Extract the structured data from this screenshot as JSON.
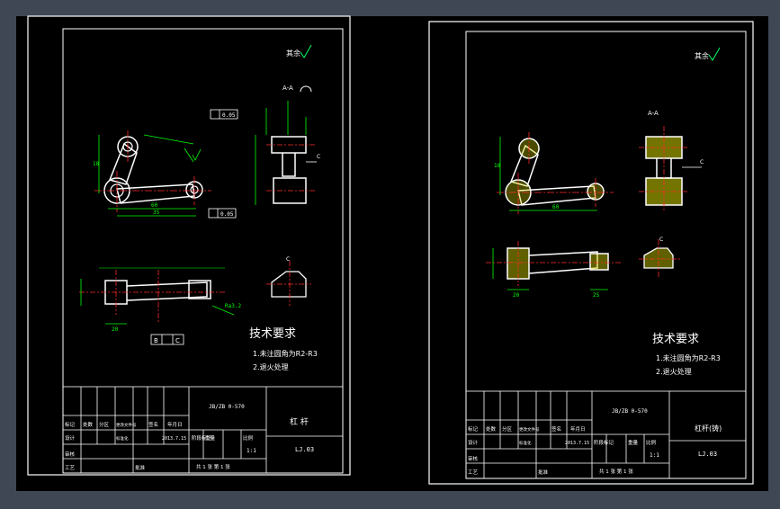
{
  "app": {
    "background": "#3f4654",
    "canvas": "#000000"
  },
  "colors": {
    "frame": "#ffffff",
    "part": "#ffffff",
    "dimension": "#00ff00",
    "center": "#ff2a2a",
    "hatch": "#d4d400",
    "text": "#ffffff",
    "accent": "#00ff66"
  },
  "sheets": [
    {
      "surface_finish": "其余",
      "section_label": "A-A",
      "section_c": "C",
      "tech_title": "技术要求",
      "tech_items": [
        "1.未注圆角为R2-R3",
        "2.退火处理"
      ],
      "tolerances": [
        "0.05",
        "0.05"
      ],
      "datum": [
        "B",
        "C"
      ],
      "dims": [
        "18",
        "20",
        "35",
        "60",
        "12",
        "8",
        "25",
        "17",
        "Ra3.2"
      ],
      "title_block": {
        "standard": "JB/ZB 0-570",
        "part_name": "杠   杆",
        "drawing_no": "LJ.03",
        "headers": [
          "标记",
          "处数",
          "分区",
          "更改文件号",
          "签名",
          "年月日"
        ],
        "row_design": "设计",
        "date": "2013.7.15",
        "standardization": "标准化",
        "stage": "阶段标记",
        "weight": "重量",
        "scale_label": "比例",
        "scale": "1:1",
        "review": "审核",
        "process": "工艺",
        "approve": "批准",
        "sheets_info": "共 1 张   第 1 张"
      }
    },
    {
      "surface_finish": "其余",
      "section_label": "A-A",
      "section_c": "C",
      "tech_title": "技术要求",
      "tech_items": [
        "1.未注圆角为R2-R3",
        "2.退火处理"
      ],
      "dims": [
        "18",
        "20",
        "35",
        "60",
        "12",
        "25"
      ],
      "title_block": {
        "standard": "JB/ZB 0-570",
        "part_name": "杠杆(铸)",
        "drawing_no": "LJ.03",
        "headers": [
          "标记",
          "处数",
          "分区",
          "更改文件号",
          "签名",
          "年月日"
        ],
        "row_design": "设计",
        "date": "2013.7.15",
        "standardization": "标准化",
        "stage": "阶段标记",
        "weight": "重量",
        "scale_label": "比例",
        "scale": "1:1",
        "review": "审核",
        "process": "工艺",
        "approve": "批准",
        "sheets_info": "共 1 张   第 1 张"
      }
    }
  ]
}
